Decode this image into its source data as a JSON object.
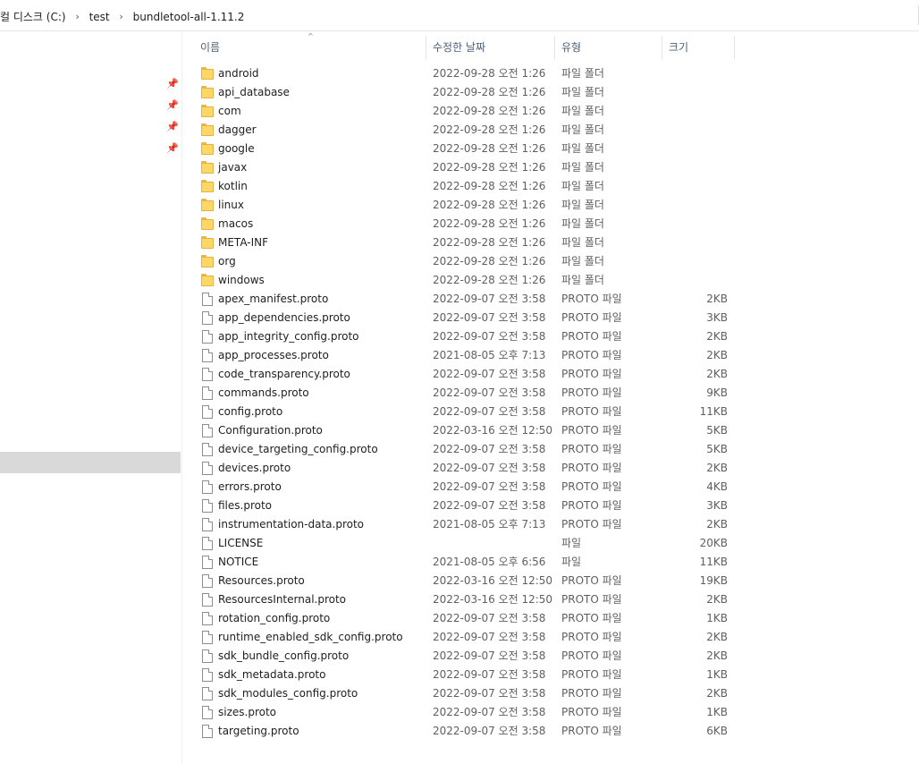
{
  "breadcrumb": {
    "items": [
      "컬 디스크 (C:)",
      "test",
      "bundletool-all-1.11.2"
    ]
  },
  "columns": {
    "name": "이름",
    "date": "수정한 날짜",
    "type": "유형",
    "size": "크기"
  },
  "sort_indicator": "^",
  "files": [
    {
      "name": "android",
      "date": "2022-09-28 오전 1:26",
      "type": "파일 폴더",
      "size": "",
      "kind": "folder"
    },
    {
      "name": "api_database",
      "date": "2022-09-28 오전 1:26",
      "type": "파일 폴더",
      "size": "",
      "kind": "folder"
    },
    {
      "name": "com",
      "date": "2022-09-28 오전 1:26",
      "type": "파일 폴더",
      "size": "",
      "kind": "folder"
    },
    {
      "name": "dagger",
      "date": "2022-09-28 오전 1:26",
      "type": "파일 폴더",
      "size": "",
      "kind": "folder"
    },
    {
      "name": "google",
      "date": "2022-09-28 오전 1:26",
      "type": "파일 폴더",
      "size": "",
      "kind": "folder"
    },
    {
      "name": "javax",
      "date": "2022-09-28 오전 1:26",
      "type": "파일 폴더",
      "size": "",
      "kind": "folder"
    },
    {
      "name": "kotlin",
      "date": "2022-09-28 오전 1:26",
      "type": "파일 폴더",
      "size": "",
      "kind": "folder"
    },
    {
      "name": "linux",
      "date": "2022-09-28 오전 1:26",
      "type": "파일 폴더",
      "size": "",
      "kind": "folder"
    },
    {
      "name": "macos",
      "date": "2022-09-28 오전 1:26",
      "type": "파일 폴더",
      "size": "",
      "kind": "folder"
    },
    {
      "name": "META-INF",
      "date": "2022-09-28 오전 1:26",
      "type": "파일 폴더",
      "size": "",
      "kind": "folder"
    },
    {
      "name": "org",
      "date": "2022-09-28 오전 1:26",
      "type": "파일 폴더",
      "size": "",
      "kind": "folder"
    },
    {
      "name": "windows",
      "date": "2022-09-28 오전 1:26",
      "type": "파일 폴더",
      "size": "",
      "kind": "folder"
    },
    {
      "name": "apex_manifest.proto",
      "date": "2022-09-07 오전 3:58",
      "type": "PROTO 파일",
      "size": "2KB",
      "kind": "file"
    },
    {
      "name": "app_dependencies.proto",
      "date": "2022-09-07 오전 3:58",
      "type": "PROTO 파일",
      "size": "3KB",
      "kind": "file"
    },
    {
      "name": "app_integrity_config.proto",
      "date": "2022-09-07 오전 3:58",
      "type": "PROTO 파일",
      "size": "2KB",
      "kind": "file"
    },
    {
      "name": "app_processes.proto",
      "date": "2021-08-05 오후 7:13",
      "type": "PROTO 파일",
      "size": "2KB",
      "kind": "file"
    },
    {
      "name": "code_transparency.proto",
      "date": "2022-09-07 오전 3:58",
      "type": "PROTO 파일",
      "size": "2KB",
      "kind": "file"
    },
    {
      "name": "commands.proto",
      "date": "2022-09-07 오전 3:58",
      "type": "PROTO 파일",
      "size": "9KB",
      "kind": "file"
    },
    {
      "name": "config.proto",
      "date": "2022-09-07 오전 3:58",
      "type": "PROTO 파일",
      "size": "11KB",
      "kind": "file"
    },
    {
      "name": "Configuration.proto",
      "date": "2022-03-16 오전 12:50",
      "type": "PROTO 파일",
      "size": "5KB",
      "kind": "file"
    },
    {
      "name": "device_targeting_config.proto",
      "date": "2022-09-07 오전 3:58",
      "type": "PROTO 파일",
      "size": "5KB",
      "kind": "file"
    },
    {
      "name": "devices.proto",
      "date": "2022-09-07 오전 3:58",
      "type": "PROTO 파일",
      "size": "2KB",
      "kind": "file"
    },
    {
      "name": "errors.proto",
      "date": "2022-09-07 오전 3:58",
      "type": "PROTO 파일",
      "size": "4KB",
      "kind": "file"
    },
    {
      "name": "files.proto",
      "date": "2022-09-07 오전 3:58",
      "type": "PROTO 파일",
      "size": "3KB",
      "kind": "file"
    },
    {
      "name": "instrumentation-data.proto",
      "date": "2021-08-05 오후 7:13",
      "type": "PROTO 파일",
      "size": "2KB",
      "kind": "file"
    },
    {
      "name": "LICENSE",
      "date": "",
      "type": "파일",
      "size": "20KB",
      "kind": "file"
    },
    {
      "name": "NOTICE",
      "date": "2021-08-05 오후 6:56",
      "type": "파일",
      "size": "11KB",
      "kind": "file"
    },
    {
      "name": "Resources.proto",
      "date": "2022-03-16 오전 12:50",
      "type": "PROTO 파일",
      "size": "19KB",
      "kind": "file"
    },
    {
      "name": "ResourcesInternal.proto",
      "date": "2022-03-16 오전 12:50",
      "type": "PROTO 파일",
      "size": "2KB",
      "kind": "file"
    },
    {
      "name": "rotation_config.proto",
      "date": "2022-09-07 오전 3:58",
      "type": "PROTO 파일",
      "size": "1KB",
      "kind": "file"
    },
    {
      "name": "runtime_enabled_sdk_config.proto",
      "date": "2022-09-07 오전 3:58",
      "type": "PROTO 파일",
      "size": "2KB",
      "kind": "file"
    },
    {
      "name": "sdk_bundle_config.proto",
      "date": "2022-09-07 오전 3:58",
      "type": "PROTO 파일",
      "size": "2KB",
      "kind": "file"
    },
    {
      "name": "sdk_metadata.proto",
      "date": "2022-09-07 오전 3:58",
      "type": "PROTO 파일",
      "size": "1KB",
      "kind": "file"
    },
    {
      "name": "sdk_modules_config.proto",
      "date": "2022-09-07 오전 3:58",
      "type": "PROTO 파일",
      "size": "2KB",
      "kind": "file"
    },
    {
      "name": "sizes.proto",
      "date": "2022-09-07 오전 3:58",
      "type": "PROTO 파일",
      "size": "1KB",
      "kind": "file"
    },
    {
      "name": "targeting.proto",
      "date": "2022-09-07 오전 3:58",
      "type": "PROTO 파일",
      "size": "6KB",
      "kind": "file"
    }
  ],
  "colors": {
    "folder_fill": "#ffd766",
    "selection": "#d9d9d9",
    "header_text": "#4c607a"
  }
}
